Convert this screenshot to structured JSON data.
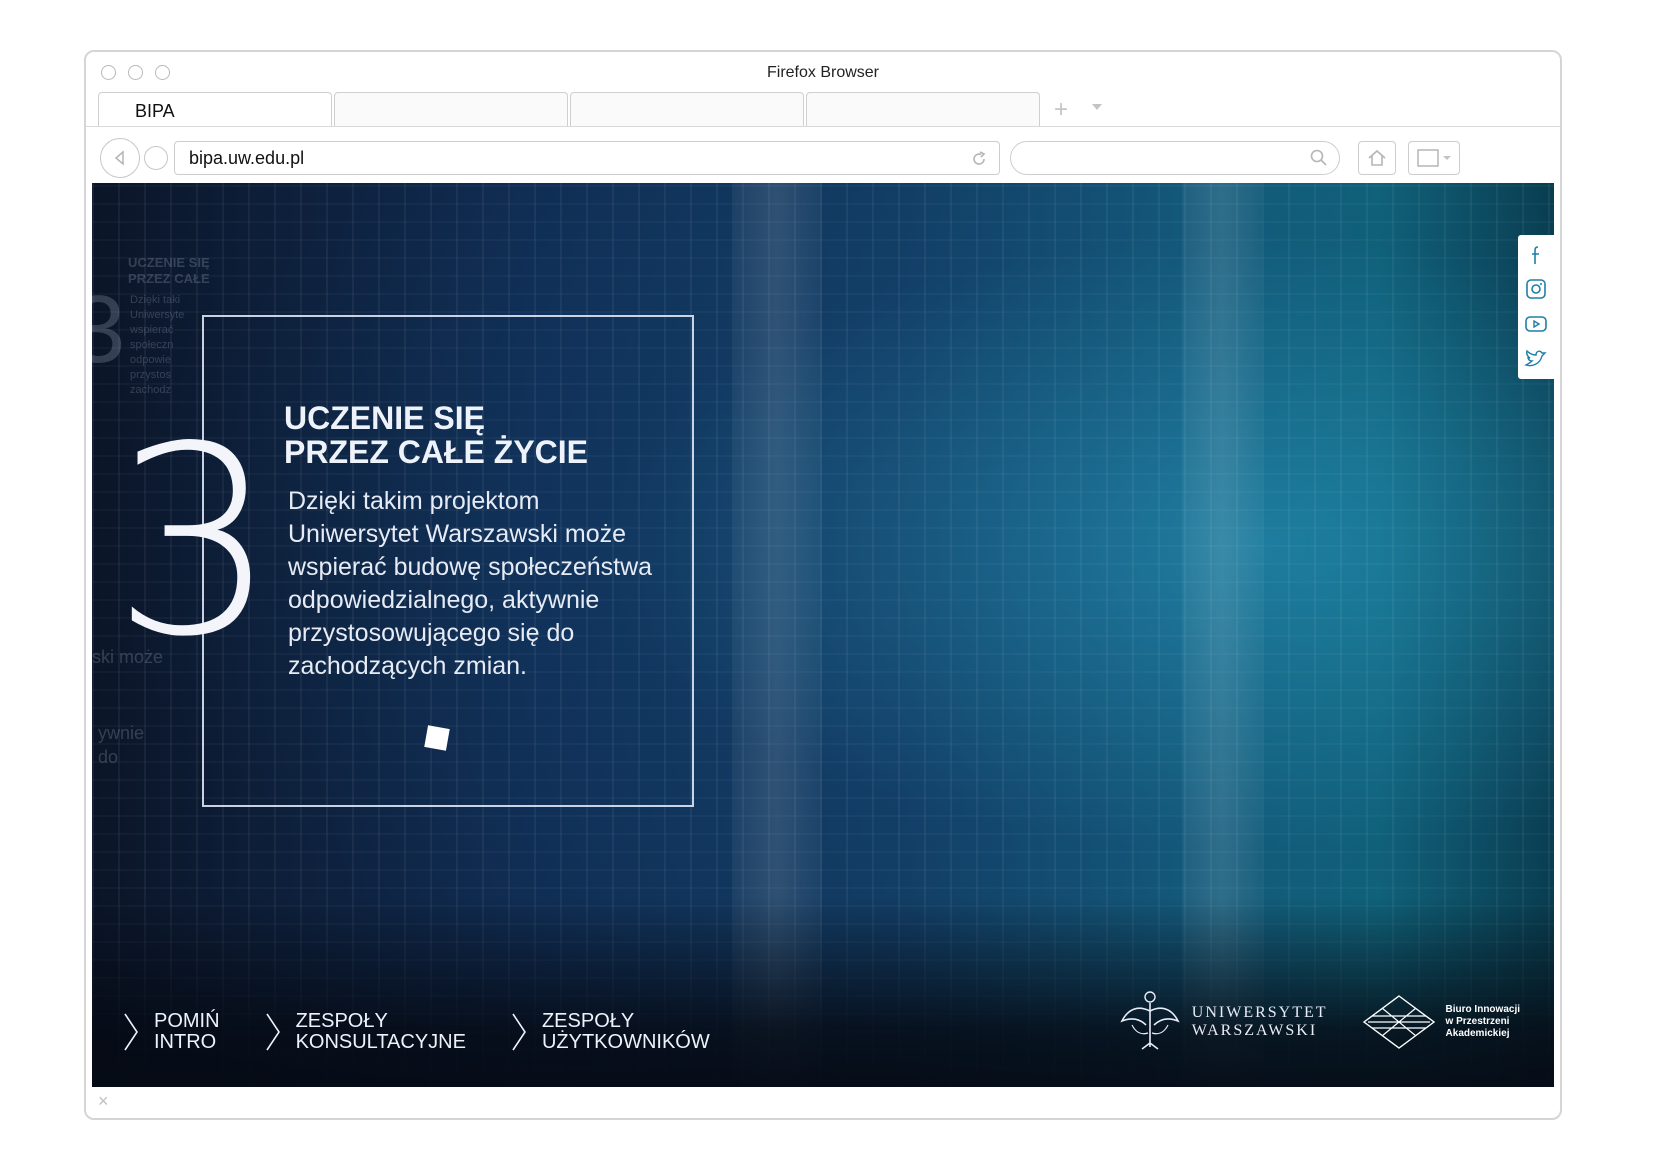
{
  "window": {
    "title": "Firefox Browser"
  },
  "tabs": [
    {
      "label": "BIPA",
      "active": true
    },
    {
      "label": "",
      "active": false
    },
    {
      "label": "",
      "active": false
    },
    {
      "label": "",
      "active": false
    }
  ],
  "toolbar": {
    "url": "bipa.uw.edu.pl",
    "new_tab": "+"
  },
  "content": {
    "number": "3",
    "heading": "UCZENIE SIĘ\nPRZEZ CAŁE ŻYCIE",
    "body": "Dzięki takim projektom Uniwersytet Warszawski może wspierać budowę społeczeństwa odpowiedzialnego, aktywnie przystosowującego się do zachodzących zmian.",
    "ghost_heading": "UCZENIE SIĘ\nPRZEZ CAŁE",
    "ghost_body": "Dzięki taki\nUniwersyte\nwspierać\nspołeczn\nodpowie\nprzystos\nzachodz",
    "ghost_side_1": "ski może",
    "ghost_side_2": "ywnie\ndo"
  },
  "social": [
    "facebook-icon",
    "instagram-icon",
    "youtube-icon",
    "twitter-icon"
  ],
  "footer_nav": [
    {
      "label": "POMIŃ\nINTRO"
    },
    {
      "label": "ZESPOŁY\nKONSULTACYJNE"
    },
    {
      "label": "ZESPOŁY\nUŻYTKOWNIKÓW"
    }
  ],
  "logos": {
    "uw": "UNIWERSYTET\nWARSZAWSKI",
    "biuro": "Biuro Innowacji\nw Przestrzeni\nAkademickiej"
  },
  "status": {
    "close": "×"
  },
  "colors": {
    "accent": "#0f6478",
    "text_light": "#eef2fa"
  }
}
